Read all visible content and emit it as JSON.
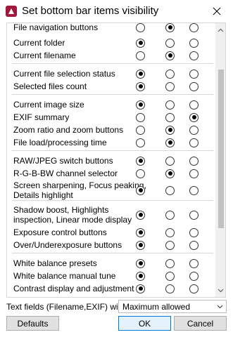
{
  "window": {
    "title": "Set bottom bar items visibility",
    "app_icon": "app-icon",
    "close_icon": "close-icon"
  },
  "items": [
    {
      "label": "File navigation buttons",
      "selected": 1
    },
    {
      "label": "Current folder",
      "selected": 0
    },
    {
      "label": "Current filename",
      "selected": 1
    },
    {
      "label": "Current file selection status",
      "selected": 0
    },
    {
      "label": "Selected files count",
      "selected": 0
    },
    {
      "label": "Current image size",
      "selected": 0
    },
    {
      "label": "EXIF summary",
      "selected": 2
    },
    {
      "label": "Zoom ratio and zoom buttons",
      "selected": 1
    },
    {
      "label": "File load/processing time",
      "selected": 1
    },
    {
      "label": "RAW/JPEG switch buttons",
      "selected": 0
    },
    {
      "label": "R-G-B-BW channel selector",
      "selected": 1
    },
    {
      "label": "Screen sharpening, Focus peaking,\nDetails highlight",
      "selected": 0
    },
    {
      "label": "Shadow boost, Highlights\ninspection, Linear mode display",
      "selected": 0
    },
    {
      "label": "Exposure control buttons",
      "selected": 0
    },
    {
      "label": "Over/Underexposure buttons",
      "selected": 0
    },
    {
      "label": "White balance presets",
      "selected": 0
    },
    {
      "label": "White balance manual tune",
      "selected": 0
    },
    {
      "label": "Contrast display and adjustment",
      "selected": 0
    }
  ],
  "scroll": {
    "up_icon": "chevron-up-icon",
    "down_icon": "chevron-down-icon"
  },
  "text_fields": {
    "label": "Text fields (Filename,EXIF) width:",
    "value": "Maximum allowed",
    "arrow_icon": "chevron-down-icon"
  },
  "buttons": {
    "defaults": "Defaults",
    "ok": "OK",
    "cancel": "Cancel"
  }
}
